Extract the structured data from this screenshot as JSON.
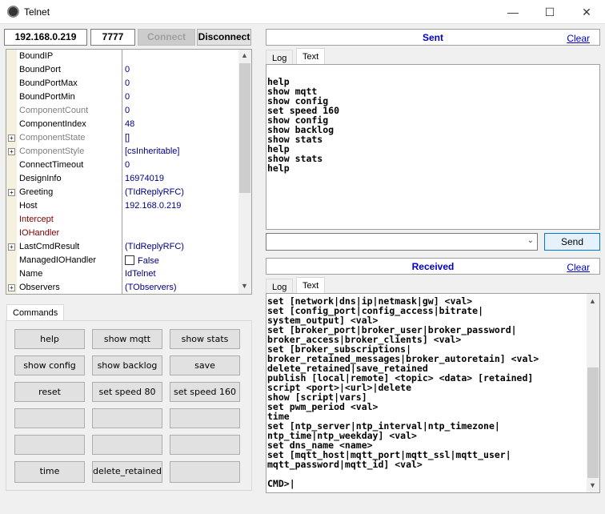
{
  "window": {
    "title": "Telnet",
    "minimize": "—",
    "maximize": "☐",
    "close": "✕"
  },
  "connection": {
    "host": "192.168.0.219",
    "port": "7777",
    "connect_label": "Connect",
    "disconnect_label": "Disconnect"
  },
  "properties": [
    {
      "name": "BoundIP",
      "value": "",
      "style": "normal",
      "expandable": false
    },
    {
      "name": "BoundPort",
      "value": "0",
      "style": "normal",
      "expandable": false
    },
    {
      "name": "BoundPortMax",
      "value": "0",
      "style": "normal",
      "expandable": false
    },
    {
      "name": "BoundPortMin",
      "value": "0",
      "style": "normal",
      "expandable": false
    },
    {
      "name": "ComponentCount",
      "value": "0",
      "style": "readonly",
      "expandable": false
    },
    {
      "name": "ComponentIndex",
      "value": "48",
      "style": "normal",
      "expandable": false
    },
    {
      "name": "ComponentState",
      "value": "[]",
      "style": "readonly",
      "expandable": true
    },
    {
      "name": "ComponentStyle",
      "value": "[csInheritable]",
      "style": "readonly",
      "expandable": true
    },
    {
      "name": "ConnectTimeout",
      "value": "0",
      "style": "normal",
      "expandable": false
    },
    {
      "name": "DesignInfo",
      "value": "16974019",
      "style": "normal",
      "expandable": false
    },
    {
      "name": "Greeting",
      "value": "(TIdReplyRFC)",
      "style": "normal",
      "expandable": true
    },
    {
      "name": "Host",
      "value": "192.168.0.219",
      "style": "normal",
      "expandable": false
    },
    {
      "name": "Intercept",
      "value": "",
      "style": "reference",
      "expandable": false
    },
    {
      "name": "IOHandler",
      "value": "",
      "style": "reference",
      "expandable": false
    },
    {
      "name": "LastCmdResult",
      "value": "(TIdReplyRFC)",
      "style": "normal",
      "expandable": true
    },
    {
      "name": "ManagedIOHandler",
      "value": "False",
      "style": "checkbox",
      "expandable": false
    },
    {
      "name": "Name",
      "value": "IdTelnet",
      "style": "normal",
      "expandable": false
    },
    {
      "name": "Observers",
      "value": "(TObservers)",
      "style": "normal",
      "expandable": true
    }
  ],
  "commands": {
    "tab_label": "Commands",
    "buttons": [
      "help",
      "show mqtt",
      "show stats",
      "show config",
      "show backlog",
      "save",
      "reset",
      "set speed 80",
      "set speed 160",
      "",
      "",
      "",
      "",
      "",
      "",
      "time",
      "delete_retained",
      ""
    ]
  },
  "sent": {
    "title": "Sent",
    "clear_label": "Clear",
    "tabs": [
      "Log",
      "Text"
    ],
    "selected_tab": "Text",
    "text": "help\nshow mqtt\nshow config\nset speed 160\nshow config\nshow backlog\nshow stats\nhelp\nshow stats\nhelp",
    "command_input": "",
    "send_label": "Send"
  },
  "received": {
    "title": "Received",
    "clear_label": "Clear",
    "tabs": [
      "Log",
      "Text"
    ],
    "selected_tab": "Text",
    "text": "set [network|dns|ip|netmask|gw] <val>\nset [config_port|config_access|bitrate|\nsystem_output] <val>\nset [broker_port|broker_user|broker_password|\nbroker_access|broker_clients] <val>\nset [broker_subscriptions|\nbroker_retained_messages|broker_autoretain] <val>\ndelete_retained|save_retained\npublish [local|remote] <topic> <data> [retained]\nscript <port>|<url>|delete\nshow [script|vars]\nset pwm_period <val>\ntime\nset [ntp_server|ntp_interval|ntp_timezone|\nntp_time|ntp_weekday] <val>\nset dns_name <name>\nset [mqtt_host|mqtt_port|mqtt_ssl|mqtt_user|\nmqtt_password|mqtt_id] <val>\n\nCMD>|"
  }
}
